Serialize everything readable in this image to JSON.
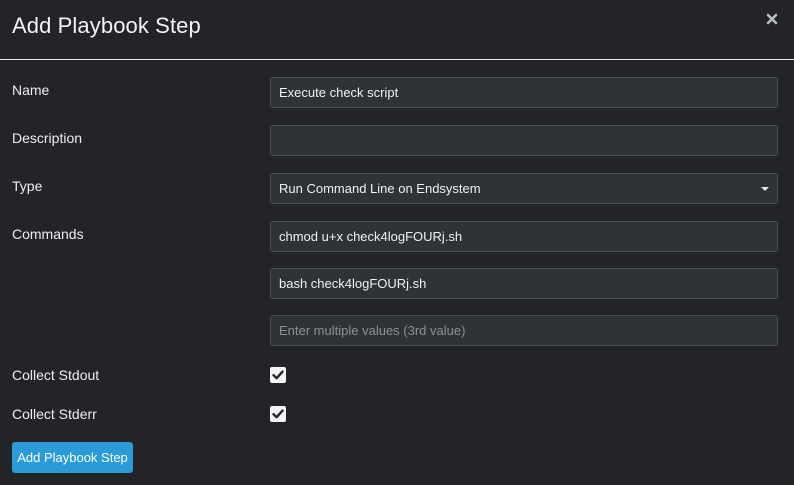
{
  "modal": {
    "title": "Add Playbook Step",
    "close_icon": "close-icon"
  },
  "form": {
    "name": {
      "label": "Name",
      "value": "Execute check script"
    },
    "description": {
      "label": "Description",
      "value": ""
    },
    "type": {
      "label": "Type",
      "selected": "Run Command Line on Endsystem"
    },
    "commands": {
      "label": "Commands",
      "values": [
        "chmod u+x check4logFOURj.sh",
        "bash check4logFOURj.sh"
      ],
      "placeholder": "Enter multiple values (3rd value)"
    },
    "collect_stdout": {
      "label": "Collect Stdout",
      "checked": true
    },
    "collect_stderr": {
      "label": "Collect Stderr",
      "checked": true
    },
    "submit_label": "Add Playbook Step"
  },
  "colors": {
    "background": "#222428",
    "input_background": "#2f3237",
    "accent": "#2a9bd6"
  }
}
